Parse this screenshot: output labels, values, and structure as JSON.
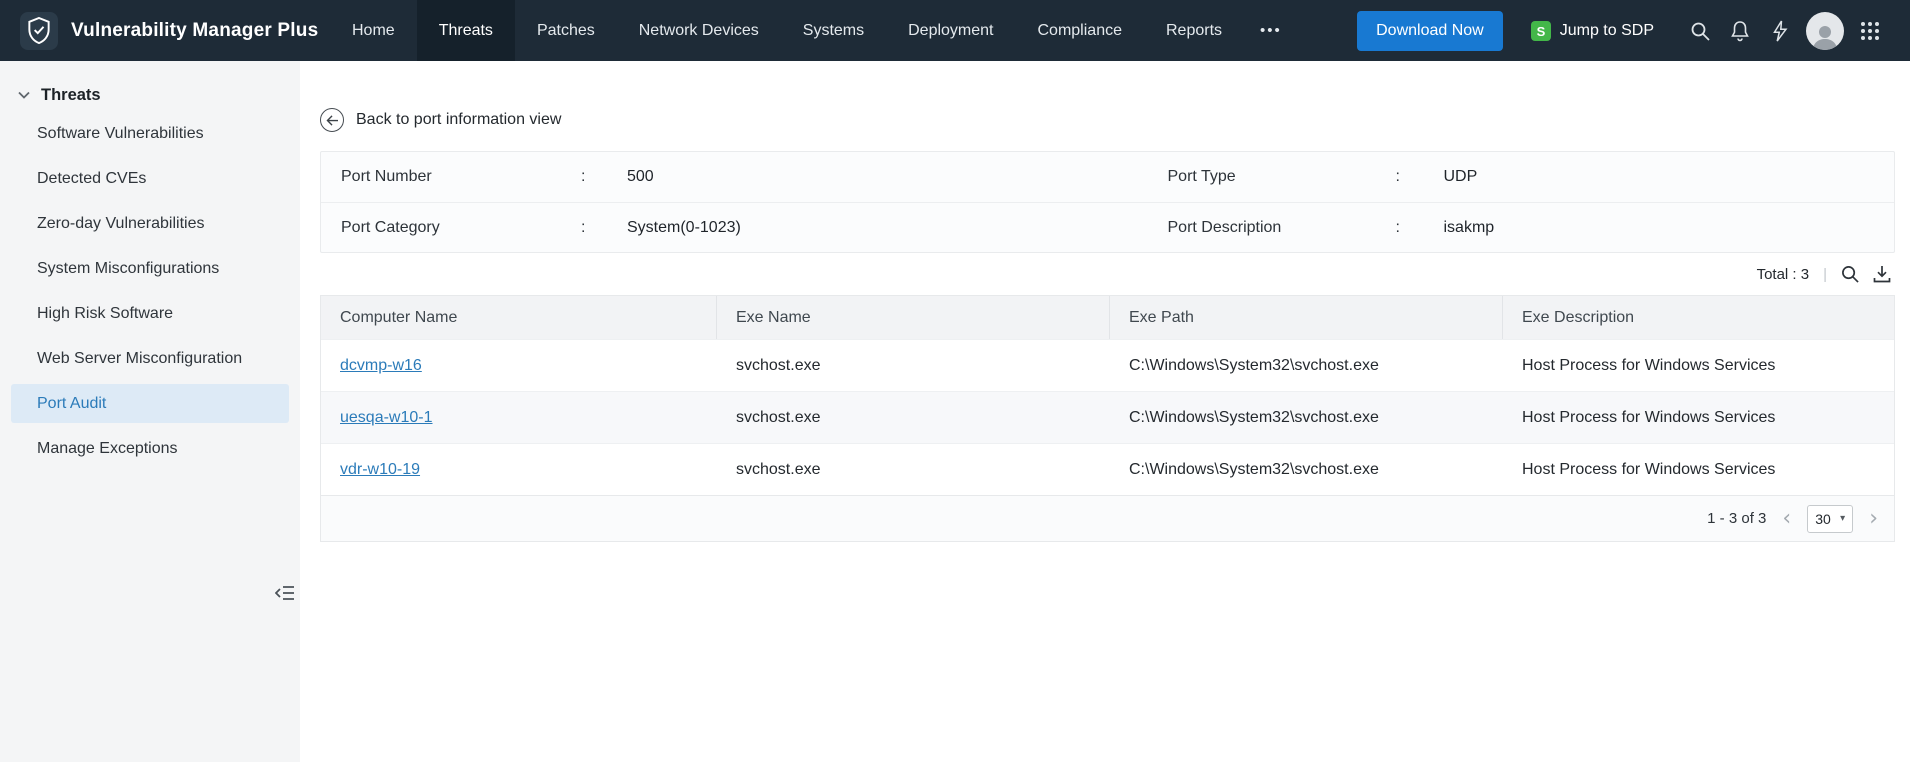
{
  "navbar": {
    "brand": "Vulnerability Manager Plus",
    "items": [
      {
        "label": "Home"
      },
      {
        "label": "Threats"
      },
      {
        "label": "Patches"
      },
      {
        "label": "Network Devices"
      },
      {
        "label": "Systems"
      },
      {
        "label": "Deployment"
      },
      {
        "label": "Compliance"
      },
      {
        "label": "Reports"
      }
    ],
    "more_label": "•••",
    "download_button": "Download Now",
    "jump_to_sdp": "Jump to SDP"
  },
  "sidebar": {
    "section": "Threats",
    "items": [
      {
        "label": "Software Vulnerabilities"
      },
      {
        "label": "Detected CVEs"
      },
      {
        "label": "Zero-day Vulnerabilities"
      },
      {
        "label": "System Misconfigurations"
      },
      {
        "label": "High Risk Software"
      },
      {
        "label": "Web Server Misconfiguration"
      },
      {
        "label": "Port Audit"
      },
      {
        "label": "Manage Exceptions"
      }
    ]
  },
  "main": {
    "back_link": "Back to port information view",
    "port_info": {
      "fields": [
        {
          "label": "Port Number",
          "colon": ":",
          "value": "500"
        },
        {
          "label": "Port Type",
          "colon": ":",
          "value": "UDP"
        },
        {
          "label": "Port Category",
          "colon": ":",
          "value": "System(0-1023)"
        },
        {
          "label": "Port Description",
          "colon": ":",
          "value": "isakmp"
        }
      ]
    },
    "toolbar": {
      "total_label": "Total : 3",
      "separator": "|"
    },
    "table": {
      "columns": [
        "Computer Name",
        "Exe Name",
        "Exe Path",
        "Exe Description"
      ],
      "rows": [
        {
          "computer": "dcvmp-w16",
          "exe": "svchost.exe",
          "path": "C:\\Windows\\System32\\svchost.exe",
          "desc": "Host Process for Windows Services"
        },
        {
          "computer": "uesqa-w10-1",
          "exe": "svchost.exe",
          "path": "C:\\Windows\\System32\\svchost.exe",
          "desc": "Host Process for Windows Services"
        },
        {
          "computer": "vdr-w10-19",
          "exe": "svchost.exe",
          "path": "C:\\Windows\\System32\\svchost.exe",
          "desc": "Host Process for Windows Services"
        }
      ]
    },
    "pagination": {
      "range": "1 - 3 of 3",
      "prev": "‹",
      "next": "›",
      "page_size": "30",
      "caret": "▾"
    }
  }
}
